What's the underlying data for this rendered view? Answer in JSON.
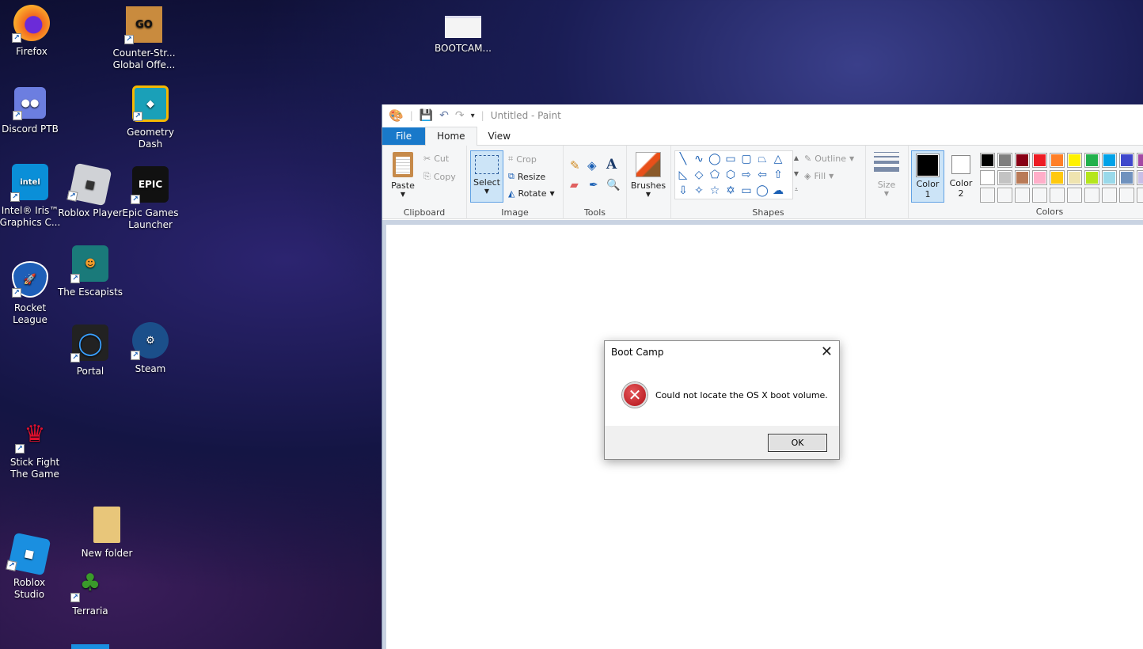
{
  "desktop": {
    "icons": [
      {
        "id": "firefox",
        "lines": [
          "Firefox"
        ],
        "color": "#e8602a"
      },
      {
        "id": "csgo",
        "lines": [
          "Counter-Str...",
          "Global Offe..."
        ],
        "color": "#b8792a"
      },
      {
        "id": "bootcamp",
        "lines": [
          "BOOTCAM..."
        ],
        "color": "#f0f0f0"
      },
      {
        "id": "discord",
        "lines": [
          "Discord PTB"
        ],
        "color": "#5865f2"
      },
      {
        "id": "geometry-dash",
        "lines": [
          "Geometry",
          "Dash"
        ],
        "color": "#f5b800"
      },
      {
        "id": "intel",
        "lines": [
          "Intel® Iris™",
          "Graphics C..."
        ],
        "color": "#0a8fd8"
      },
      {
        "id": "roblox-player",
        "lines": [
          "Roblox Player"
        ],
        "color": "#c9ccd0"
      },
      {
        "id": "epic",
        "lines": [
          "Epic Games",
          "Launcher"
        ],
        "color": "#111111"
      },
      {
        "id": "rocket-league",
        "lines": [
          "Rocket",
          "League"
        ],
        "color": "#1e5fb8"
      },
      {
        "id": "escapists",
        "lines": [
          "The Escapists"
        ],
        "color": "#1a7a7a"
      },
      {
        "id": "portal",
        "lines": [
          "Portal"
        ],
        "color": "#222222"
      },
      {
        "id": "steam",
        "lines": [
          "Steam"
        ],
        "color": "#1b4f8a"
      },
      {
        "id": "stick-fight",
        "lines": [
          "Stick Fight",
          "The Game"
        ],
        "color": "#c8102e"
      },
      {
        "id": "new-folder",
        "lines": [
          "New folder"
        ],
        "color": "#e8c67a"
      },
      {
        "id": "roblox-studio",
        "lines": [
          "Roblox",
          "Studio"
        ],
        "color": "#1a8fe0"
      },
      {
        "id": "terraria",
        "lines": [
          "Terraria"
        ],
        "color": "#3a8a2a"
      }
    ]
  },
  "paint": {
    "title": "Untitled - Paint",
    "tabs": [
      "File",
      "Home",
      "View"
    ],
    "clipboard": {
      "label": "Clipboard",
      "paste": "Paste",
      "cut": "Cut",
      "copy": "Copy"
    },
    "image": {
      "label": "Image",
      "select": "Select",
      "crop": "Crop",
      "resize": "Resize",
      "rotate": "Rotate"
    },
    "tools": {
      "label": "Tools"
    },
    "brushes": {
      "label": "Brushes"
    },
    "shapes": {
      "label": "Shapes",
      "outline": "Outline",
      "fill": "Fill",
      "glyphs": [
        "╲",
        "∿",
        "◯",
        "▭",
        "▢",
        "⏢",
        "△",
        "◺",
        "◇",
        "⬠",
        "⬡",
        "⇨",
        "⇦",
        "⇧",
        "⇩",
        "✧",
        "☆",
        "✡",
        "▭",
        "◯",
        "☁"
      ]
    },
    "size": {
      "label": "Size"
    },
    "color1": {
      "label1": "Color",
      "label2": "1",
      "value": "#000000"
    },
    "color2": {
      "label1": "Color",
      "label2": "2",
      "value": "#ffffff"
    },
    "colors": {
      "label": "Colors",
      "palette": [
        [
          "#000000",
          "#7f7f7f",
          "#880015",
          "#ed1c24",
          "#ff7f27",
          "#fff200",
          "#22b14c",
          "#00a2e8",
          "#3f48cc",
          "#a349a4"
        ],
        [
          "#ffffff",
          "#c3c3c3",
          "#b97a57",
          "#ffaec9",
          "#ffc90e",
          "#efe4b0",
          "#b5e61d",
          "#99d9ea",
          "#7092be",
          "#c8bfe7"
        ]
      ]
    }
  },
  "dialog": {
    "title": "Boot Camp",
    "message": "Could not locate the OS X boot volume.",
    "ok": "OK"
  }
}
